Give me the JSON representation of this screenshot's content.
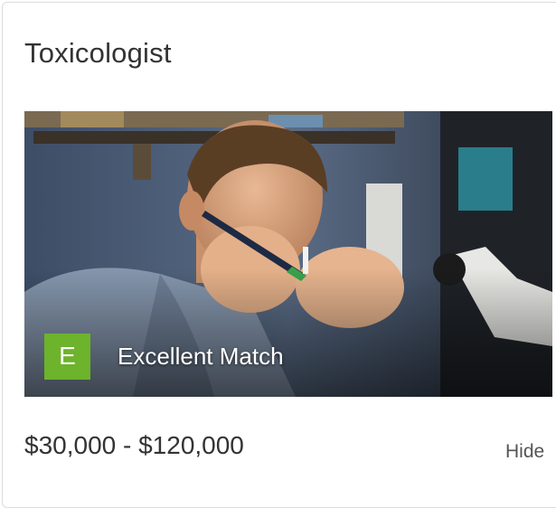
{
  "card": {
    "title": "Toxicologist",
    "match": {
      "badge_letter": "E",
      "label": "Excellent Match",
      "badge_color": "#6db32c"
    },
    "salary_range": "$30,000 - $120,000",
    "hide_label": "Hide"
  }
}
